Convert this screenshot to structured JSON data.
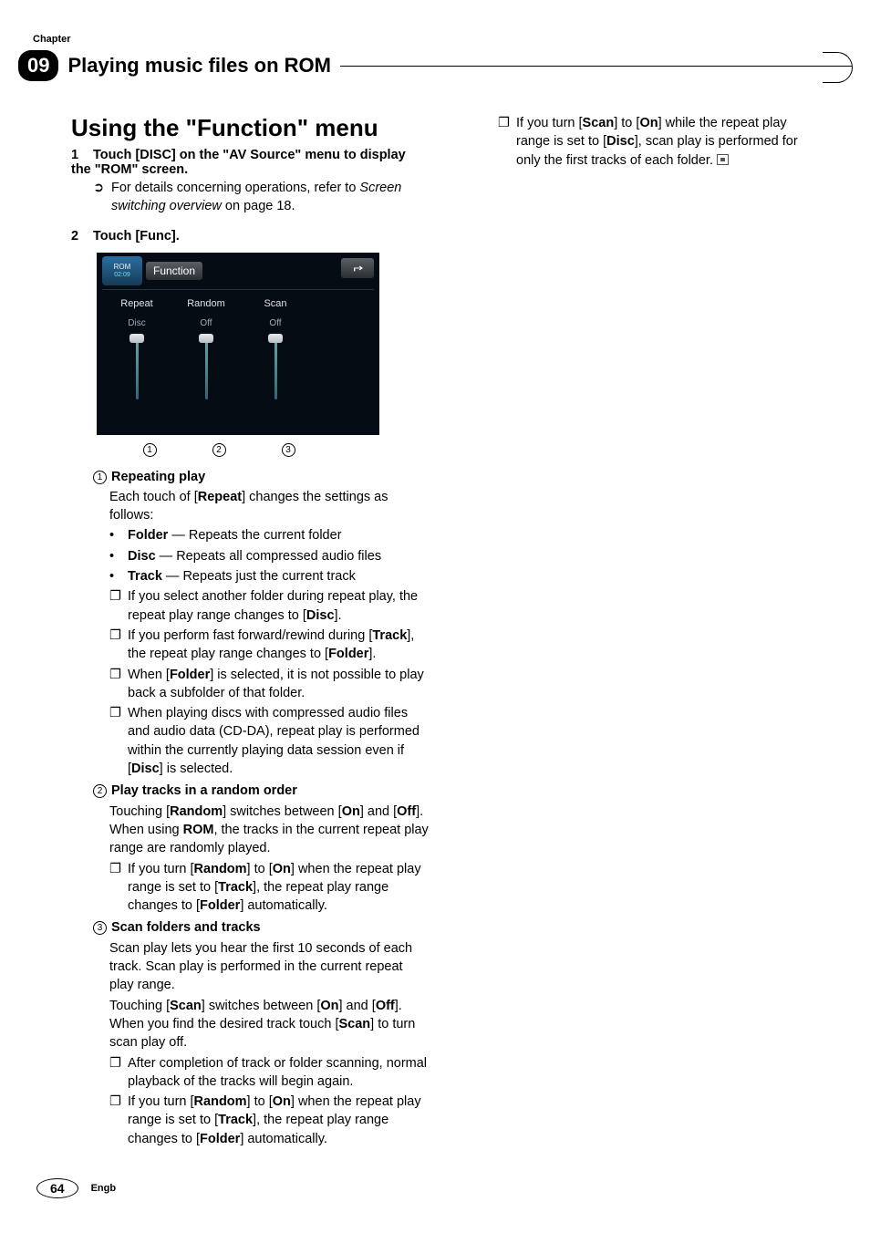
{
  "header": {
    "chapter_label": "Chapter",
    "chapter_number": "09",
    "chapter_title": "Playing music files on ROM"
  },
  "section_title": "Using the \"Function\" menu",
  "steps": {
    "s1": {
      "num": "1",
      "text_pre": "Touch [DISC] on the \"AV Source\" menu to display the \"ROM\" screen.",
      "note_pre": "For details concerning operations, refer to ",
      "note_link": "Screen switching overview",
      "note_post": " on page 18."
    },
    "s2": {
      "num": "2",
      "text": "Touch [Func]."
    }
  },
  "screenshot": {
    "disc_label": "ROM",
    "time": "02:09",
    "title": "Function",
    "cols": [
      {
        "name": "Repeat",
        "val": "Disc"
      },
      {
        "name": "Random",
        "val": "Off"
      },
      {
        "name": "Scan",
        "val": "Off"
      }
    ]
  },
  "callouts": {
    "c1": "1",
    "c2": "2",
    "c3": "3"
  },
  "items": {
    "i1": {
      "num": "1",
      "title": "Repeating play",
      "lead_a": "Each touch of [",
      "lead_b": "Repeat",
      "lead_c": "] changes the settings as follows:",
      "li1a": "Folder",
      "li1b": " — Repeats the current folder",
      "li2a": "Disc",
      "li2b": " — Repeats all compressed audio files",
      "li3a": "Track",
      "li3b": " — Repeats just the current track",
      "n1a": "If you select another folder during repeat play, the repeat play range changes to [",
      "n1b": "Disc",
      "n1c": "].",
      "n2a": "If you perform fast forward/rewind during [",
      "n2b": "Track",
      "n2c": "], the repeat play range changes to [",
      "n2d": "Folder",
      "n2e": "].",
      "n3a": "When [",
      "n3b": "Folder",
      "n3c": "] is selected, it is not possible to play back a subfolder of that folder.",
      "n4a": "When playing discs with compressed audio files and audio data (CD-DA), repeat play is performed within the currently playing data session even if [",
      "n4b": "Disc",
      "n4c": "] is selected."
    },
    "i2": {
      "num": "2",
      "title": "Play tracks in a random order",
      "p1a": "Touching [",
      "p1b": "Random",
      "p1c": "] switches between [",
      "p1d": "On",
      "p1e": "] and [",
      "p1f": "Off",
      "p1g": "]. When using ",
      "p1h": "ROM",
      "p1i": ", the tracks in the current repeat play range are randomly played.",
      "n1a": "If you turn [",
      "n1b": "Random",
      "n1c": "] to [",
      "n1d": "On",
      "n1e": "] when the repeat play range is set to [",
      "n1f": "Track",
      "n1g": "], the repeat play range changes to [",
      "n1h": "Folder",
      "n1i": "] automatically."
    },
    "i3": {
      "num": "3",
      "title": "Scan folders and tracks",
      "p1": "Scan play lets you hear the first 10 seconds of each track. Scan play is performed in the current repeat play range.",
      "p2a": "Touching [",
      "p2b": "Scan",
      "p2c": "] switches between [",
      "p2d": "On",
      "p2e": "] and [",
      "p2f": "Off",
      "p2g": "]. When you find the desired track touch [",
      "p2h": "Scan",
      "p2i": "] to turn scan play off.",
      "n1": "After completion of track or folder scanning, normal playback of the tracks will begin again.",
      "n2a": "If you turn [",
      "n2b": "Random",
      "n2c": "] to [",
      "n2d": "On",
      "n2e": "] when the repeat play range is set to [",
      "n2f": "Track",
      "n2g": "], the repeat play range changes to [",
      "n2h": "Folder",
      "n2i": "] automatically.",
      "n3a": "If you turn [",
      "n3b": "Scan",
      "n3c": "] to [",
      "n3d": "On",
      "n3e": "] while the repeat play range is set to [",
      "n3f": "Disc",
      "n3g": "], scan play is performed for only the first tracks of each folder."
    }
  },
  "footer": {
    "page": "64",
    "lang": "Engb"
  }
}
